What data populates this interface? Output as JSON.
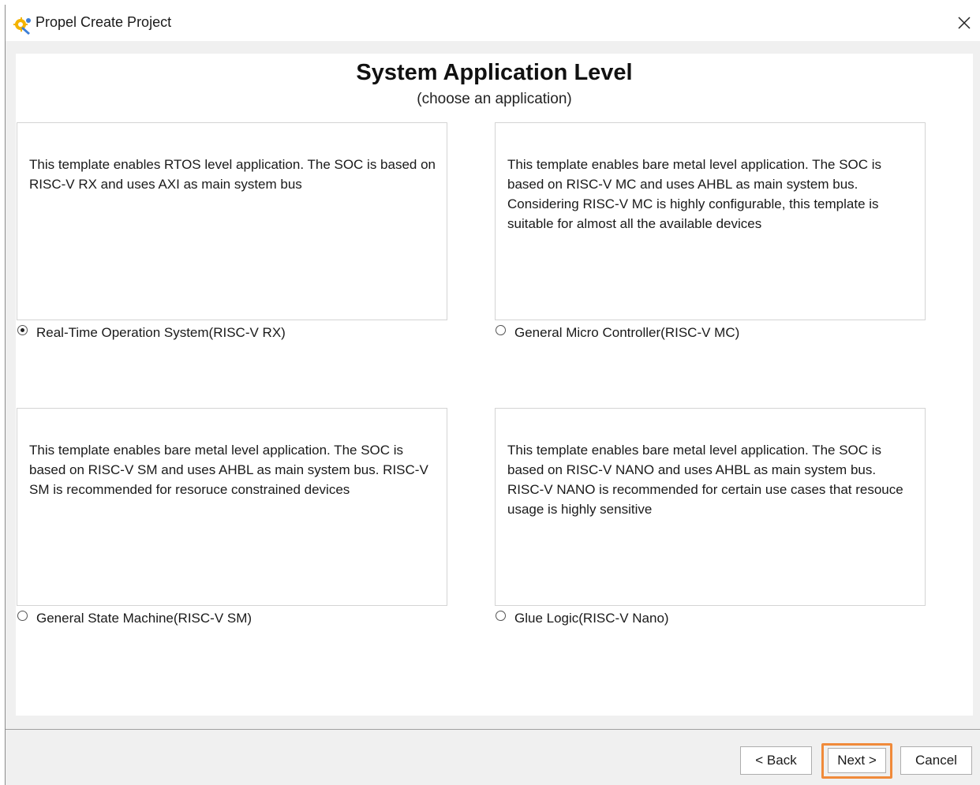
{
  "window": {
    "title": "Propel Create Project"
  },
  "page": {
    "heading": "System Application Level",
    "subheading": "(choose an application)"
  },
  "options": [
    {
      "description": "This template enables RTOS level application. The SOC is based on RISC-V RX and uses AXI as main system bus",
      "label": "Real-Time Operation System(RISC-V RX)",
      "selected": true
    },
    {
      "description": "This template enables bare metal level application. The SOC is based on RISC-V MC and uses AHBL as main system bus. Considering RISC-V MC is highly configurable, this template is suitable for almost all the available devices",
      "label": "General Micro Controller(RISC-V MC)",
      "selected": false
    },
    {
      "description": "This template enables bare metal level application. The SOC is based on RISC-V SM and uses AHBL as main system bus. RISC-V SM is recommended for resoruce constrained devices",
      "label": "General State Machine(RISC-V SM)",
      "selected": false
    },
    {
      "description": "This template enables bare metal level application. The SOC is based on RISC-V NANO and uses AHBL as main system bus. RISC-V NANO is recommended for certain use cases that resouce usage is highly sensitive",
      "label": "Glue Logic(RISC-V Nano)",
      "selected": false
    }
  ],
  "buttons": {
    "back_label": "< Back",
    "next_label": "Next >",
    "cancel_label": "Cancel"
  },
  "colors": {
    "highlight": "#f08a3a"
  },
  "icons": {
    "app": "propel-app-icon",
    "close": "close-icon"
  }
}
